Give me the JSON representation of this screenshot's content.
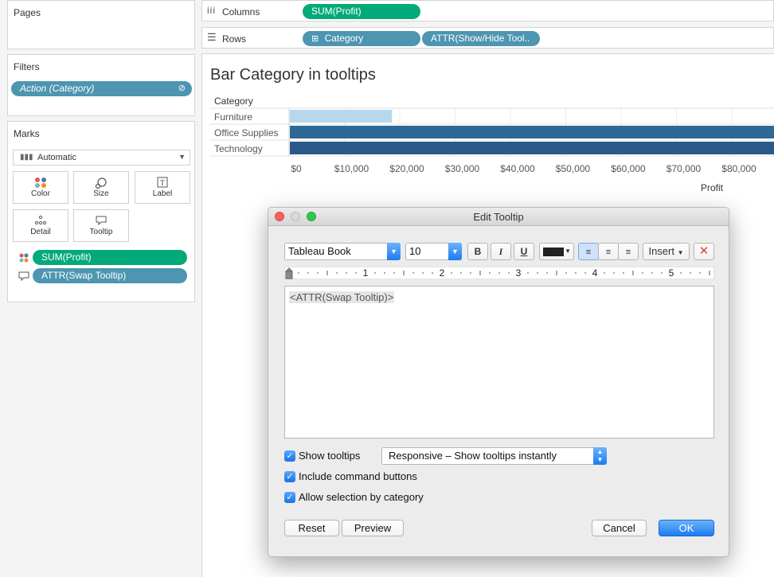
{
  "left_panel": {
    "pages": {
      "title": "Pages"
    },
    "filters": {
      "title": "Filters",
      "pill": "Action (Category)"
    },
    "marks": {
      "title": "Marks",
      "type": "Automatic",
      "buttons": {
        "color": "Color",
        "size": "Size",
        "label": "Label",
        "detail": "Detail",
        "tooltip": "Tooltip"
      },
      "fields": [
        {
          "label": "SUM(Profit)",
          "icon": "color-dots-icon"
        },
        {
          "label": "ATTR(Swap Tooltip)",
          "icon": "tooltip-icon"
        }
      ]
    }
  },
  "shelves": {
    "columns": {
      "label": "Columns",
      "pills": [
        "SUM(Profit)"
      ]
    },
    "rows": {
      "label": "Rows",
      "pills": [
        "Category",
        "ATTR(Show/Hide Tool.."
      ]
    }
  },
  "view": {
    "title": "Bar Category in tooltips"
  },
  "chart_data": {
    "type": "bar",
    "orientation": "horizontal",
    "title": "Bar Category in tooltips",
    "row_header": "Category",
    "xlabel": "Profit",
    "categories": [
      "Furniture",
      "Office Supplies",
      "Technology"
    ],
    "values": [
      18451,
      122491,
      145455
    ],
    "colors": [
      "#b6d7ee",
      "#2e6896",
      "#2a5989"
    ],
    "x_ticks": [
      "$0",
      "$10,000",
      "$20,000",
      "$30,000",
      "$40,000",
      "$50,000",
      "$60,000",
      "$70,000",
      "$80,000",
      "$"
    ],
    "x_tick_values": [
      0,
      10000,
      20000,
      30000,
      40000,
      50000,
      60000,
      70000,
      80000,
      90000
    ]
  },
  "dialog": {
    "title": "Edit Tooltip",
    "font": "Tableau Book",
    "size": "10",
    "bold": "B",
    "italic": "I",
    "underline": "U",
    "insert": "Insert",
    "ruler_numbers": [
      "1",
      "2",
      "3",
      "4",
      "5"
    ],
    "content": "<ATTR(Swap Tooltip)>",
    "show_tooltips": "Show tooltips",
    "tooltip_mode": "Responsive – Show tooltips instantly",
    "include_command_buttons": "Include command buttons",
    "allow_selection": "Allow selection by category",
    "reset": "Reset",
    "preview": "Preview",
    "cancel": "Cancel",
    "ok": "OK"
  },
  "colors": {
    "green_pill": "#04a97a",
    "blue_pill": "#4d95b0",
    "mac_blue": "#1b7cf2"
  }
}
